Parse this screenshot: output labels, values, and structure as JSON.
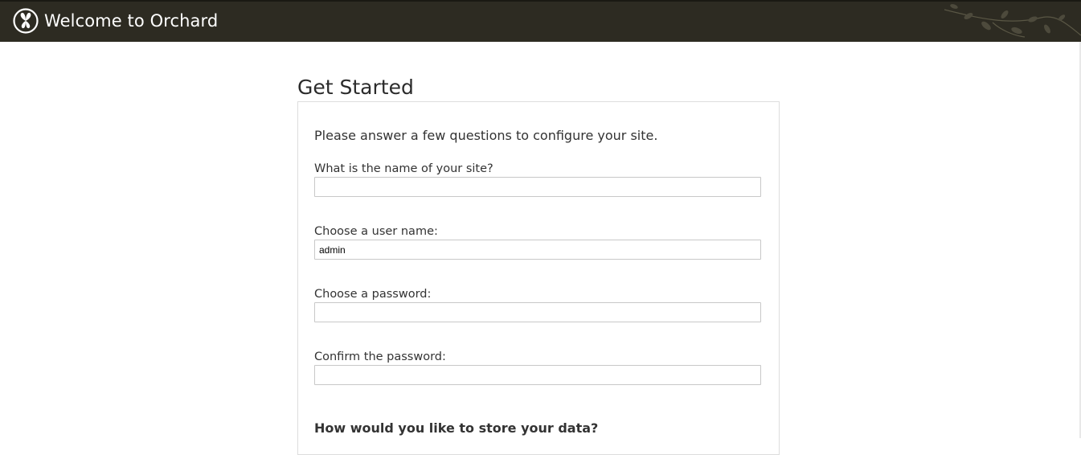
{
  "header": {
    "title": "Welcome to Orchard",
    "logo_icon": "orchard-logo-icon",
    "decoration_icon": "leaf-branch-icon",
    "background_color": "#2d2b22"
  },
  "main": {
    "page_title": "Get Started",
    "intro": "Please answer a few questions to configure your site.",
    "fields": {
      "site_name": {
        "label": "What is the name of your site?",
        "value": "",
        "placeholder": ""
      },
      "user_name": {
        "label": "Choose a user name:",
        "value": "admin",
        "placeholder": ""
      },
      "password": {
        "label": "Choose a password:",
        "value": "",
        "placeholder": ""
      },
      "confirm_password": {
        "label": "Confirm the password:",
        "value": "",
        "placeholder": ""
      }
    },
    "data_section_heading": "How would you like to store your data?"
  }
}
